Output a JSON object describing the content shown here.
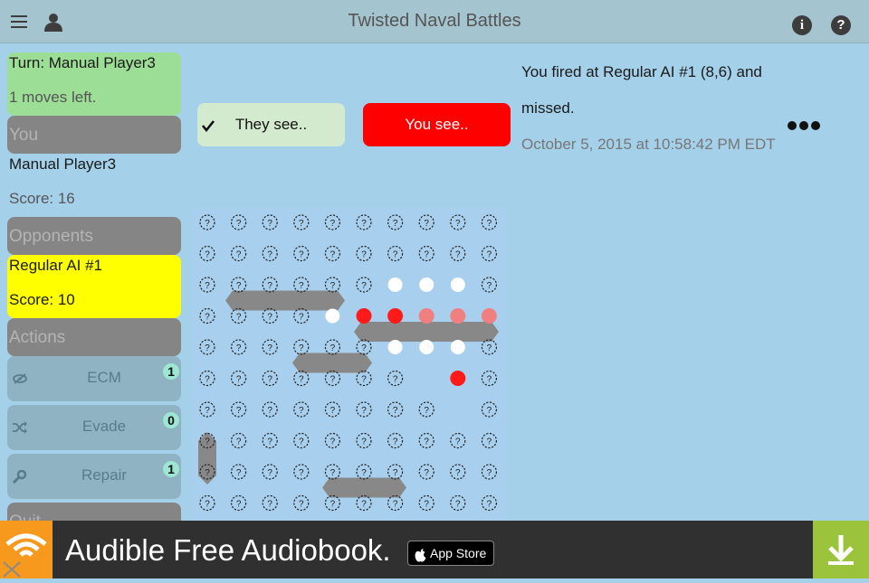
{
  "header": {
    "title": "Twisted Naval Battles",
    "menu_icon": "hamburger-menu-icon",
    "profile_icon": "person-icon",
    "info_icon": "info-icon",
    "help_icon": "help-icon"
  },
  "sidebar": {
    "turn_label": "Turn: Manual Player3",
    "moves_left": "1 moves left.",
    "you_header": "You",
    "player_name": "Manual Player3",
    "player_score": "Score: 16",
    "opponents_header": "Opponents",
    "opponent_name": "Regular AI #1",
    "opponent_score": "Score: 10",
    "actions_header": "Actions",
    "actions": [
      {
        "label": "ECM",
        "count": "1",
        "icon": "eye-slash-icon"
      },
      {
        "label": "Evade",
        "count": "0",
        "icon": "shuffle-icon"
      },
      {
        "label": "Repair",
        "count": "1",
        "icon": "wrench-icon"
      }
    ],
    "quit_label": "Quit"
  },
  "view_toggle": {
    "they_see": "They see..",
    "you_see": "You see.."
  },
  "message": {
    "text": "You fired at Regular AI #1 (8,6) and missed.",
    "date": "October 5, 2015 at 10:58:42 PM EDT"
  },
  "ad": {
    "text": "Audible Free Audiobook.",
    "store": "App Store"
  },
  "colors": {
    "background": "#a4d0ea",
    "turn_card": "#9dde96",
    "opponent_card": "#ffff00",
    "you_see_active": "#ff0000",
    "hit_marker": "#ff1a1a",
    "damaged_marker": "#f08080",
    "miss_marker": "#ffffff",
    "ship_gray": "#888888"
  }
}
